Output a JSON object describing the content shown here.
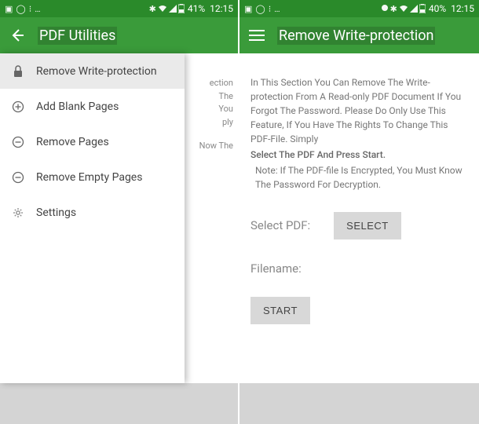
{
  "left": {
    "status": {
      "battery": "41%",
      "time": "12:15"
    },
    "appbar": {
      "title": "PDF Utilities"
    },
    "drawer": {
      "items": [
        {
          "label": "Remove Write-protection",
          "icon": "lock"
        },
        {
          "label": "Add Blank Pages",
          "icon": "plus"
        },
        {
          "label": "Remove Pages",
          "icon": "minus"
        },
        {
          "label": "Remove Empty Pages",
          "icon": "minus"
        },
        {
          "label": "Settings",
          "icon": "gear"
        }
      ]
    },
    "backdrop": {
      "l1": "ection",
      "l2": "The",
      "l3": "You",
      "l4": "ply",
      "l5": "Now The"
    }
  },
  "right": {
    "status": {
      "battery": "40%",
      "time": "12:15"
    },
    "appbar": {
      "title": "Remove Write-protection"
    },
    "desc": {
      "p1": "In This Section You Can Remove The Write-protection From A Read-only PDF Document If You Forgot The Password. Please Do Only Use This Feature, If You Have The Rights To Change This PDF-File. Simply",
      "p2": "Select The PDF And Press Start.",
      "note": "Note: If The PDF-file Is Encrypted, You Must Know The Password For Decryption."
    },
    "fields": {
      "select_label": "Select PDF:",
      "select_button": "SELECT",
      "filename_label": "Filename:",
      "start_button": "START"
    }
  }
}
